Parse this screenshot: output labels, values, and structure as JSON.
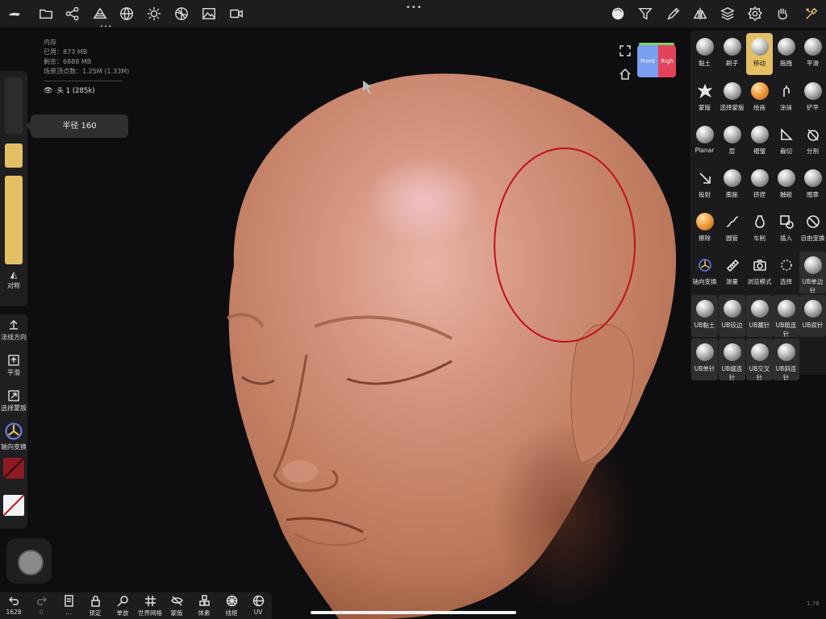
{
  "info": {
    "memory": "内存",
    "used": "已用：873 MB",
    "free": "剩余：6888 MB",
    "scene_vertices": "场景顶点数：1.25M (1.33M)",
    "object": "头 1 (285k)"
  },
  "left": {
    "radius_tip": "半径 160",
    "symmetry": "对称",
    "normal_direction": "法线方向",
    "smooth": "平滑",
    "select_mask": "选择蒙版",
    "axis_transform": "轴向变换"
  },
  "bottom": {
    "undo_count": "1628",
    "redo_count": "0",
    "items": [
      "...",
      "锁定",
      "单放",
      "世界网格",
      "蒙版",
      "体素",
      "线框",
      "UV"
    ]
  },
  "tools": [
    {
      "label": "黏土"
    },
    {
      "label": "刷子"
    },
    {
      "label": "移动"
    },
    {
      "label": "拖拽"
    },
    {
      "label": "平滑"
    },
    {
      "label": "蒙版"
    },
    {
      "label": "选择蒙版"
    },
    {
      "label": "绘画"
    },
    {
      "label": "涂抹"
    },
    {
      "label": "铲平"
    },
    {
      "label": "Planar"
    },
    {
      "label": "层"
    },
    {
      "label": "褶皱"
    },
    {
      "label": "裁切"
    },
    {
      "label": "分割"
    },
    {
      "label": "投射"
    },
    {
      "label": "膨胀"
    },
    {
      "label": "挤捏"
    },
    {
      "label": "触碰"
    },
    {
      "label": "图章"
    },
    {
      "label": "擦除"
    },
    {
      "label": "圆管"
    },
    {
      "label": "车削"
    },
    {
      "label": "插入"
    },
    {
      "label": "自由变换"
    },
    {
      "label": "轴向变换"
    },
    {
      "label": "测量"
    },
    {
      "label": "浏览模式"
    },
    {
      "label": "选择"
    },
    {
      "label": "UB单边针"
    },
    {
      "label": "UB黏土"
    },
    {
      "label": "UB铰边"
    },
    {
      "label": "UB藏针"
    },
    {
      "label": "UB粗连针"
    },
    {
      "label": "UB双针"
    },
    {
      "label": "UB单针"
    },
    {
      "label": "UB缝连针"
    },
    {
      "label": "UB交叉针"
    },
    {
      "label": "UB斜连针"
    }
  ],
  "cube": {
    "front": "Front",
    "right": "Righ"
  },
  "version": "1.76",
  "colors": {
    "accent": "#e4bf64",
    "brush_circle": "#c0101e",
    "skin": "#c98a6e",
    "background": "#0e0d0f"
  }
}
